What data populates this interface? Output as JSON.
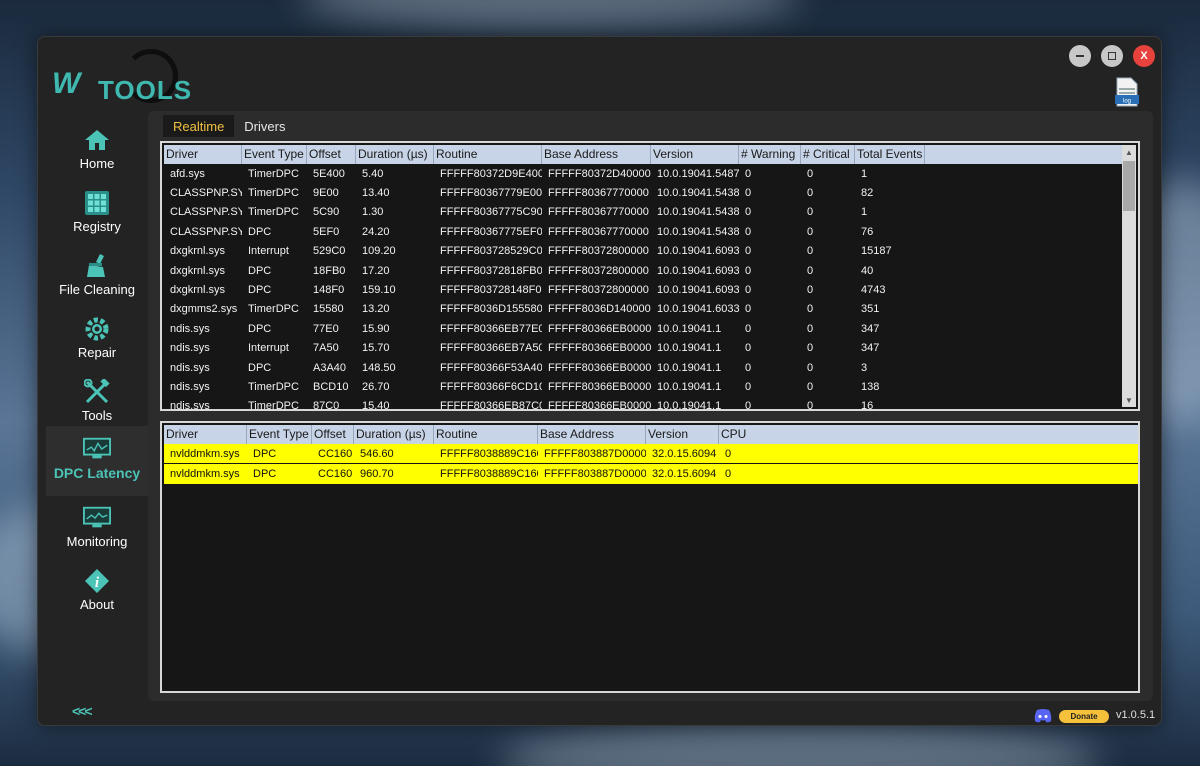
{
  "app": {
    "logo_text": "TOOLS",
    "logo_mark": "W",
    "version": "v1.0.5.1",
    "donate_label": "Donate",
    "close_label": "X",
    "log_label": "log"
  },
  "sidebar": {
    "items": [
      {
        "label": "Home",
        "icon": "house-icon"
      },
      {
        "label": "Registry",
        "icon": "grid-icon"
      },
      {
        "label": "File Cleaning",
        "icon": "broom-icon"
      },
      {
        "label": "Repair",
        "icon": "gear-icon"
      },
      {
        "label": "Tools",
        "icon": "wrench-hammer-icon"
      },
      {
        "label": "DPC Latency",
        "icon": "monitor-icon",
        "active": true
      },
      {
        "label": "Monitoring",
        "icon": "monitor-chart-icon"
      },
      {
        "label": "About",
        "icon": "info-icon"
      }
    ],
    "collapse_label": "<<<"
  },
  "tabs": [
    {
      "label": "Realtime",
      "active": true
    },
    {
      "label": "Drivers"
    }
  ],
  "top_table": {
    "columns": [
      "Driver",
      "Event Type",
      "Offset",
      "Duration (µs)",
      "Routine",
      "Base Address",
      "Version",
      "# Warning",
      "# Critical",
      "Total Events"
    ],
    "rows": [
      [
        "afd.sys",
        "TimerDPC",
        "5E400",
        "5.40",
        "FFFFF80372D9E400",
        "FFFFF80372D40000",
        "10.0.19041.5487",
        "0",
        "0",
        "1"
      ],
      [
        "CLASSPNP.SY",
        "TimerDPC",
        "9E00",
        "13.40",
        "FFFFF80367779E00",
        "FFFFF80367770000",
        "10.0.19041.5438",
        "0",
        "0",
        "82"
      ],
      [
        "CLASSPNP.SY",
        "TimerDPC",
        "5C90",
        "1.30",
        "FFFFF80367775C90",
        "FFFFF80367770000",
        "10.0.19041.5438",
        "0",
        "0",
        "1"
      ],
      [
        "CLASSPNP.SY",
        "DPC",
        "5EF0",
        "24.20",
        "FFFFF80367775EF0",
        "FFFFF80367770000",
        "10.0.19041.5438",
        "0",
        "0",
        "76"
      ],
      [
        "dxgkrnl.sys",
        "Interrupt",
        "529C0",
        "109.20",
        "FFFFF803728529C0",
        "FFFFF80372800000",
        "10.0.19041.6093",
        "0",
        "0",
        "15187"
      ],
      [
        "dxgkrnl.sys",
        "DPC",
        "18FB0",
        "17.20",
        "FFFFF80372818FB0",
        "FFFFF80372800000",
        "10.0.19041.6093",
        "0",
        "0",
        "40"
      ],
      [
        "dxgkrnl.sys",
        "DPC",
        "148F0",
        "159.10",
        "FFFFF803728148F0",
        "FFFFF80372800000",
        "10.0.19041.6093",
        "0",
        "0",
        "4743"
      ],
      [
        "dxgmms2.sys",
        "TimerDPC",
        "15580",
        "13.20",
        "FFFFF8036D155580",
        "FFFFF8036D140000",
        "10.0.19041.6033",
        "0",
        "0",
        "351"
      ],
      [
        "ndis.sys",
        "DPC",
        "77E0",
        "15.90",
        "FFFFF80366EB77E0",
        "FFFFF80366EB0000",
        "10.0.19041.1",
        "0",
        "0",
        "347"
      ],
      [
        "ndis.sys",
        "Interrupt",
        "7A50",
        "15.70",
        "FFFFF80366EB7A50",
        "FFFFF80366EB0000",
        "10.0.19041.1",
        "0",
        "0",
        "347"
      ],
      [
        "ndis.sys",
        "DPC",
        "A3A40",
        "148.50",
        "FFFFF80366F53A40",
        "FFFFF80366EB0000",
        "10.0.19041.1",
        "0",
        "0",
        "3"
      ],
      [
        "ndis.sys",
        "TimerDPC",
        "BCD10",
        "26.70",
        "FFFFF80366F6CD10",
        "FFFFF80366EB0000",
        "10.0.19041.1",
        "0",
        "0",
        "138"
      ],
      [
        "ndis.sys",
        "TimerDPC",
        "87C0",
        "15.40",
        "FFFFF80366EB87C0",
        "FFFFF80366EB0000",
        "10.0.19041.1",
        "0",
        "0",
        "16"
      ]
    ]
  },
  "bottom_table": {
    "columns": [
      "Driver",
      "Event Type",
      "Offset",
      "Duration (µs)",
      "Routine",
      "Base Address",
      "Version",
      "CPU"
    ],
    "rows": [
      [
        "nvlddmkm.sys",
        "DPC",
        "CC160",
        "546.60",
        "FFFFF8038889C160",
        "FFFFF803887D0000",
        "32.0.15.6094",
        "0"
      ],
      [
        "nvlddmkm.sys",
        "DPC",
        "CC160",
        "960.70",
        "FFFFF8038889C160",
        "FFFFF803887D0000",
        "32.0.15.6094",
        "0"
      ]
    ]
  },
  "colors": {
    "accent": "#4cc3b7",
    "highlight_row": "#ffff00",
    "tab_active": "#f0c040",
    "header_bg": "#c7d3e6"
  }
}
